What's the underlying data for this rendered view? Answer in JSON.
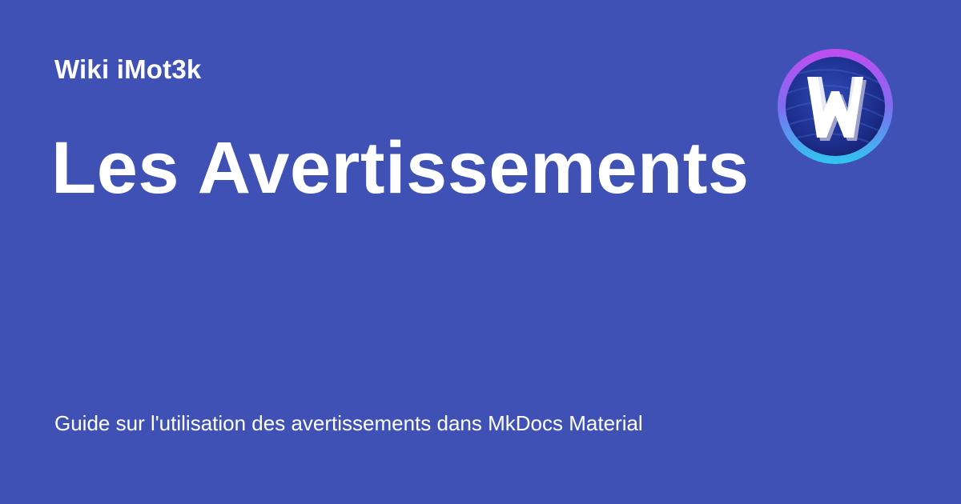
{
  "colors": {
    "background": "#3f51b5",
    "text": "#ffffff",
    "logo_ring_top": "#c04df0",
    "logo_ring_bottom": "#2fc7f0",
    "logo_inner": "#1e2f8f"
  },
  "header": {
    "site_name": "Wiki iMot3k"
  },
  "main": {
    "title": "Les Avertissements",
    "description": "Guide sur l'utilisation des avertissements dans MkDocs Material"
  },
  "logo": {
    "icon": "w-logo-icon",
    "glyph": "W"
  }
}
